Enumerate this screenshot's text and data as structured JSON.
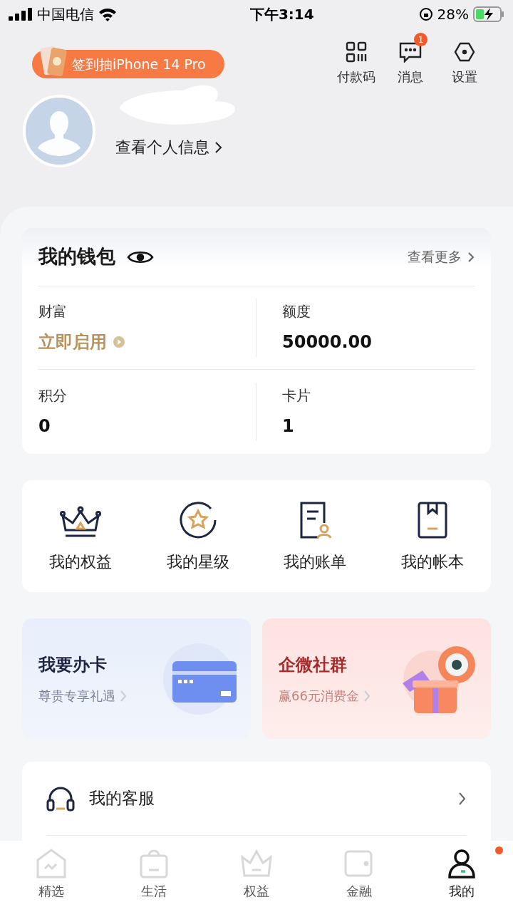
{
  "status_bar": {
    "carrier": "中国电信",
    "time": "下午3:14",
    "battery": "28%"
  },
  "promo_pill": {
    "label": "签到抽iPhone 14 Pro"
  },
  "header_actions": [
    {
      "kind": "qr",
      "label": "付款码"
    },
    {
      "kind": "message",
      "label": "消息",
      "badge": "1"
    },
    {
      "kind": "settings",
      "label": "设置"
    }
  ],
  "profile": {
    "link": "查看个人信息"
  },
  "wallet": {
    "title": "我的钱包",
    "more": "查看更多",
    "stats": [
      {
        "label": "财富",
        "value": "立即启用",
        "kind": "action"
      },
      {
        "label": "额度",
        "value": "50000.00",
        "kind": "number"
      },
      {
        "label": "积分",
        "value": "0",
        "kind": "number"
      },
      {
        "label": "卡片",
        "value": "1",
        "kind": "number"
      }
    ]
  },
  "shortcuts": [
    {
      "kind": "crown",
      "label": "我的权益"
    },
    {
      "kind": "star",
      "label": "我的星级"
    },
    {
      "kind": "bill",
      "label": "我的账单"
    },
    {
      "kind": "book",
      "label": "我的帐本"
    }
  ],
  "promos": [
    {
      "kind": "card",
      "title": "我要办卡",
      "subtitle": "尊贵专享礼遇"
    },
    {
      "kind": "gift",
      "title": "企微社群",
      "subtitle": "赢66元消费金"
    }
  ],
  "services": [
    {
      "kind": "headset",
      "label": "我的客服"
    }
  ],
  "tab_bar": [
    {
      "kind": "home",
      "label": "精选",
      "selected": false,
      "dot": false
    },
    {
      "kind": "bag",
      "label": "生活",
      "selected": false,
      "dot": false
    },
    {
      "kind": "crown",
      "label": "权益",
      "selected": false,
      "dot": false
    },
    {
      "kind": "wallet",
      "label": "金融",
      "selected": false,
      "dot": false
    },
    {
      "kind": "person",
      "label": "我的",
      "selected": true,
      "dot": true
    }
  ]
}
